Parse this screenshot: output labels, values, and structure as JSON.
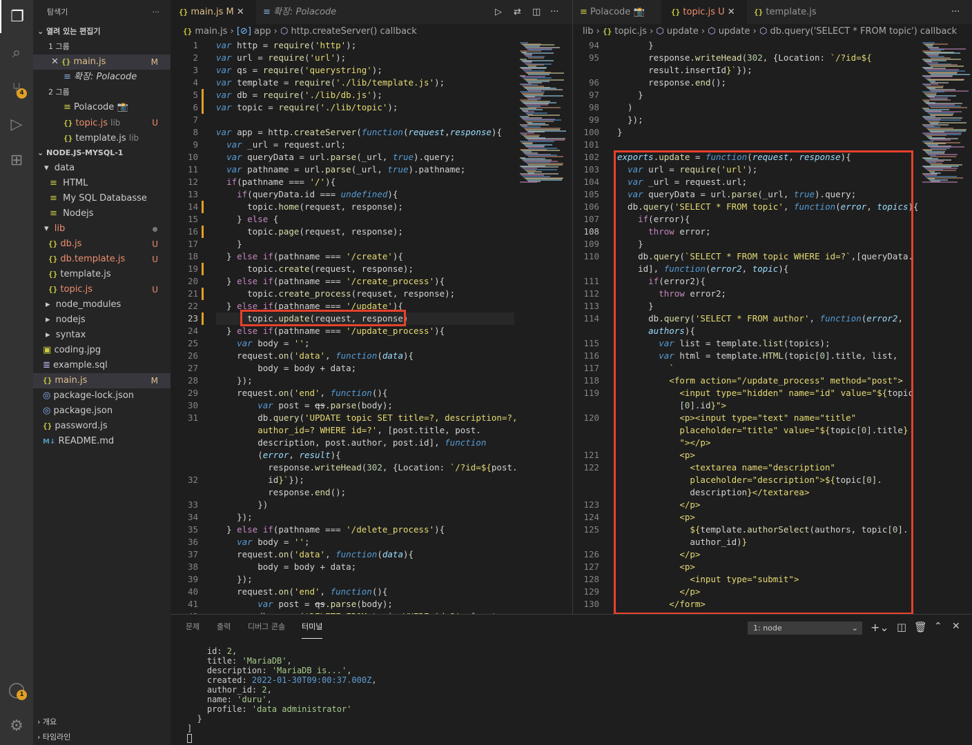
{
  "sidebar": {
    "title": "탐색기",
    "open_editors_header": "열려 있는 편집기",
    "group1": "1 그룹",
    "group1_items": [
      {
        "icon": "{}",
        "name": "main.js",
        "badge": "M"
      },
      {
        "name": "확장: Polacode"
      }
    ],
    "group2": "2 그룹",
    "group2_items": [
      {
        "name": "Polacode 📸"
      },
      {
        "icon": "{}",
        "name": "topic.js",
        "sub": "lib",
        "badge": "U"
      },
      {
        "icon": "{}",
        "name": "template.js",
        "sub": "lib"
      }
    ],
    "project_header": "NODE.JS-MYSQL-1",
    "tree": [
      {
        "name": "data",
        "type": "folder"
      },
      {
        "name": "HTML",
        "type": "file"
      },
      {
        "name": "My SQL Databasse",
        "type": "file"
      },
      {
        "name": "Nodejs",
        "type": "file"
      },
      {
        "name": "lib",
        "type": "folder"
      },
      {
        "name": "db.js",
        "badge": "U"
      },
      {
        "name": "db.template.js",
        "badge": "U"
      },
      {
        "name": "template.js"
      },
      {
        "name": "topic.js",
        "badge": "U"
      },
      {
        "name": "node_modules"
      },
      {
        "name": "nodejs"
      },
      {
        "name": "syntax"
      },
      {
        "name": "coding.jpg"
      },
      {
        "name": "example.sql"
      },
      {
        "name": "main.js",
        "badge": "M"
      },
      {
        "name": "package-lock.json"
      },
      {
        "name": "package.json"
      },
      {
        "name": "password.js"
      },
      {
        "name": "README.md"
      }
    ],
    "outline": "개요",
    "timeline": "타임라인",
    "scm_badge": "4",
    "account_badge": "1"
  },
  "left_editor": {
    "tabs": [
      {
        "icon": "{}",
        "name": "main.js",
        "badge": "M"
      },
      {
        "name": "확장: Polacode"
      }
    ],
    "breadcrumb": [
      "main.js",
      "app",
      "http.createServer() callback"
    ],
    "line_numbers": [
      "1",
      "2",
      "3",
      "4",
      "5",
      "6",
      "7",
      "8",
      "9",
      "10",
      "11",
      "12",
      "13",
      "14",
      "15",
      "16",
      "17",
      "18",
      "19",
      "20",
      "21",
      "22",
      "23",
      "24",
      "25",
      "26",
      "27",
      "28",
      "29",
      "30",
      "31",
      "",
      "",
      "",
      "",
      "32",
      "",
      "33",
      "34",
      "35",
      "36",
      "37",
      "38",
      "39",
      "40",
      "41",
      "42"
    ]
  },
  "right_editor": {
    "tabs": [
      {
        "name": "Polacode 📸"
      },
      {
        "icon": "{}",
        "name": "topic.js",
        "badge": "U"
      },
      {
        "icon": "{}",
        "name": "template.js"
      }
    ],
    "breadcrumb": [
      "lib",
      "topic.js",
      "update",
      "update",
      "db.query('SELECT * FROM topic') callback"
    ],
    "line_numbers": [
      "94",
      "95",
      "",
      "96",
      "97",
      "98",
      "99",
      "100",
      "101",
      "102",
      "103",
      "104",
      "105",
      "106",
      "107",
      "108",
      "109",
      "110",
      "",
      "111",
      "112",
      "113",
      "114",
      "",
      "115",
      "116",
      "117",
      "118",
      "119",
      "",
      "120",
      "",
      "",
      "121",
      "122",
      "",
      "",
      "123",
      "124",
      "125",
      "",
      "126",
      "127",
      "128",
      "129",
      "130"
    ]
  },
  "panel": {
    "tabs": [
      "문제",
      "출력",
      "디버그 콘솔",
      "터미널"
    ],
    "active_tab": "터미널",
    "terminal_select": "1: node"
  },
  "terminal": {
    "id": "2",
    "title": "'MariaDB'",
    "description": "'MariaDB is...'",
    "created": "2022-01-30T09:00:37.000Z",
    "author_id": "2",
    "name": "'duru'",
    "profile": "'data administrator'"
  }
}
